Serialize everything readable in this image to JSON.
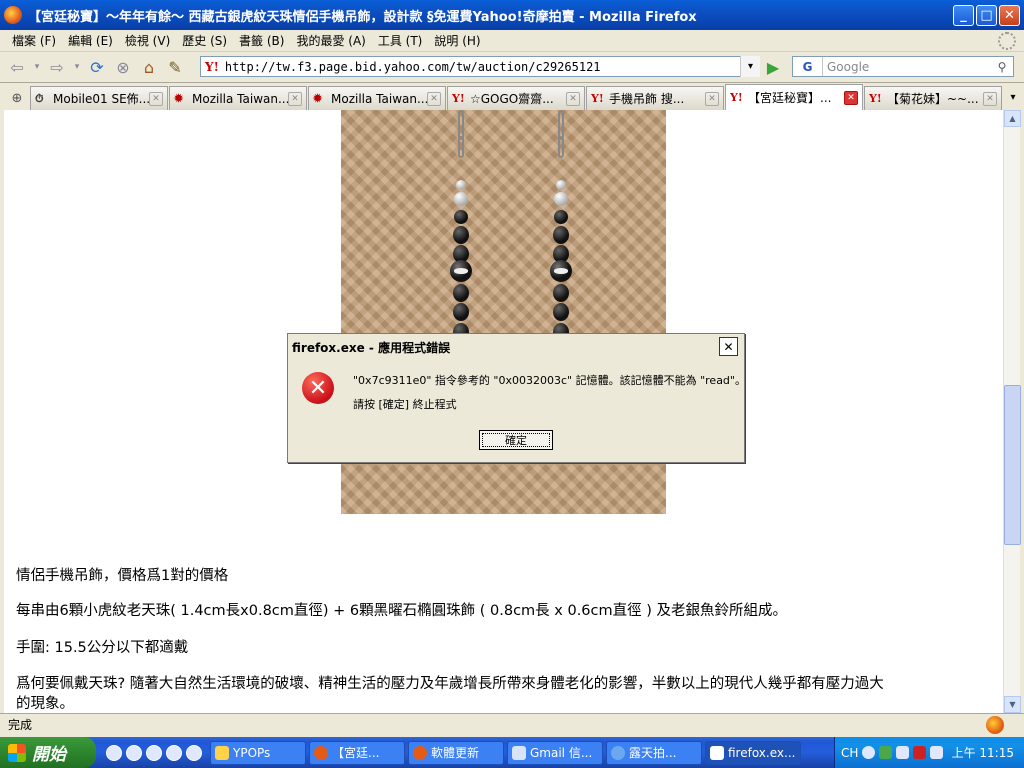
{
  "window": {
    "title": "【宮廷秘寶】～年年有餘～ 西藏古銀虎紋天珠情侶手機吊飾，設計款 §免運費Yahoo!奇摩拍賣 - Mozilla Firefox"
  },
  "menu": [
    "檔案 (F)",
    "編輯 (E)",
    "檢視 (V)",
    "歷史 (S)",
    "書籤 (B)",
    "我的最愛 (A)",
    "工具 (T)",
    "說明 (H)"
  ],
  "nav": {
    "url": "http://tw.f3.page.bid.yahoo.com/tw/auction/c29265121",
    "search_placeholder": "Google",
    "search_engine": "G"
  },
  "tabs": [
    {
      "icon": "⏱",
      "label": "Mobile01 SE佈...",
      "active": false
    },
    {
      "icon": "✹",
      "label": "Mozilla Taiwan...",
      "active": false
    },
    {
      "icon": "✹",
      "label": "Mozilla Taiwan...",
      "active": false
    },
    {
      "icon": "Y!",
      "label": "☆GOGO齋齋...",
      "active": false
    },
    {
      "icon": "Y!",
      "label": "手機吊飾 搜...",
      "active": false
    },
    {
      "icon": "Y!",
      "label": "【宮廷秘寶】...",
      "active": true
    },
    {
      "icon": "Y!",
      "label": "【菊花妹】~~...",
      "active": false
    }
  ],
  "content": {
    "line1": "情侶手機吊飾，價格爲1對的價格",
    "line2": "每串由6顆小虎紋老天珠( 1.4cm長x0.8cm直徑) + 6顆黑曜石橢圓珠飾 ( 0.8cm長 x 0.6cm直徑 ) 及老銀魚鈴所組成。",
    "line3": "手圍: 15.5公分以下都適戴",
    "line4a": "爲何要佩戴天珠?  隨著大自然生活環境的破壞、精神生活的壓力及年歲增長所帶來身體老化的影響，半數以上的現代人幾乎都有壓力過大",
    "line4b": "的現象。"
  },
  "dialog": {
    "title": "firefox.exe - 應用程式錯誤",
    "message": "\"0x7c9311e0\" 指令參考的 \"0x0032003c\" 記憶體。該記憶體不能為 \"read\"。",
    "message2": "請按 [確定] 終止程式",
    "ok_label": "確定",
    "close_glyph": "✕"
  },
  "status": {
    "text": "完成"
  },
  "taskbar": {
    "start_label": "開始",
    "tasks": [
      {
        "label": "YPOPs",
        "active": false
      },
      {
        "label": "【宮廷...",
        "active": false
      },
      {
        "label": "軟體更新",
        "active": false
      },
      {
        "label": "Gmail 信...",
        "active": false
      },
      {
        "label": "露天拍...",
        "active": false
      },
      {
        "label": "firefox.ex...",
        "active": true
      }
    ],
    "lang": "CH",
    "clock": "上午 11:15"
  }
}
